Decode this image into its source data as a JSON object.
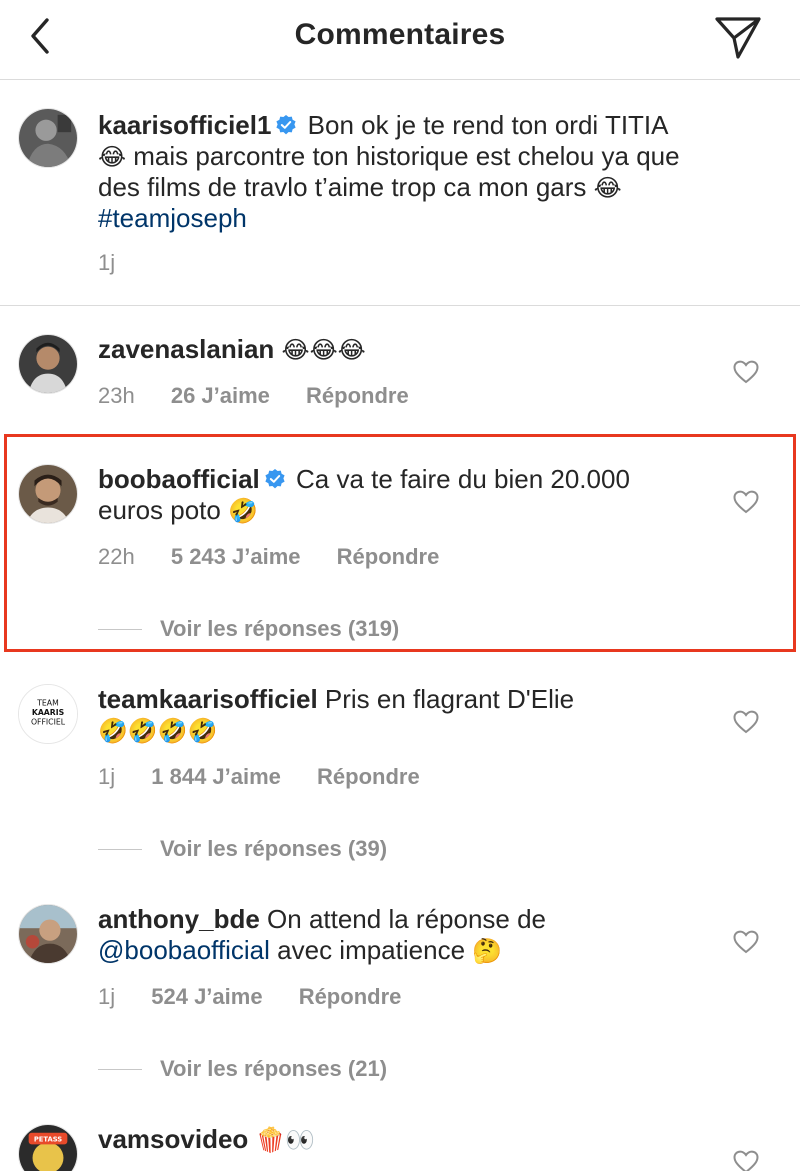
{
  "header": {
    "title": "Commentaires"
  },
  "caption": {
    "username": "kaarisofficiel1",
    "text_1": "Bon ok je te rend ton ordi TITIA",
    "emoji_1": "😂",
    "text_2": " mais parcontre ton historique est chelou ya que des films de travlo t’aime trop ca mon gars ",
    "emoji_2": "😂",
    "hashtag": "#teamjoseph",
    "time": "1j"
  },
  "comments": [
    {
      "username": "zavenaslanian",
      "emojis": "😂😂😂",
      "time": "23h",
      "likes": "26 J’aime",
      "reply": "Répondre"
    },
    {
      "username": "boobaofficial",
      "text": "Ca va te faire du bien 20.000 euros poto ",
      "emoji": "🤣",
      "time": "22h",
      "likes": "5 243 J’aime",
      "reply": "Répondre",
      "view_replies": "Voir les réponses (319)"
    },
    {
      "username": "teamkaarisofficiel",
      "text": "Pris en flagrant D'Elie ",
      "emojis": "🤣🤣🤣🤣",
      "avatar_text": [
        "TEAM",
        "KAARIS",
        "OFFICIEL"
      ],
      "time": "1j",
      "likes": "1 844 J’aime",
      "reply": "Répondre",
      "view_replies": "Voir les réponses (39)"
    },
    {
      "username": "anthony_bde",
      "text_1": "On attend la réponse de ",
      "mention": "@boobaofficial",
      "text_2": " avec impatience ",
      "emoji": "🤔",
      "time": "1j",
      "likes": "524 J’aime",
      "reply": "Répondre",
      "view_replies": "Voir les réponses (21)"
    },
    {
      "username": "vamsovideo",
      "emojis": "🍿👀",
      "avatar_text": "PETASS"
    }
  ],
  "colors": {
    "accent_link": "#003569",
    "verified": "#3897f0",
    "muted_text": "#8e8e8e",
    "highlight_border": "#e8381f"
  },
  "icons": [
    "back-chevron-icon",
    "direct-send-icon",
    "verified-badge-icon",
    "heart-outline-icon"
  ]
}
